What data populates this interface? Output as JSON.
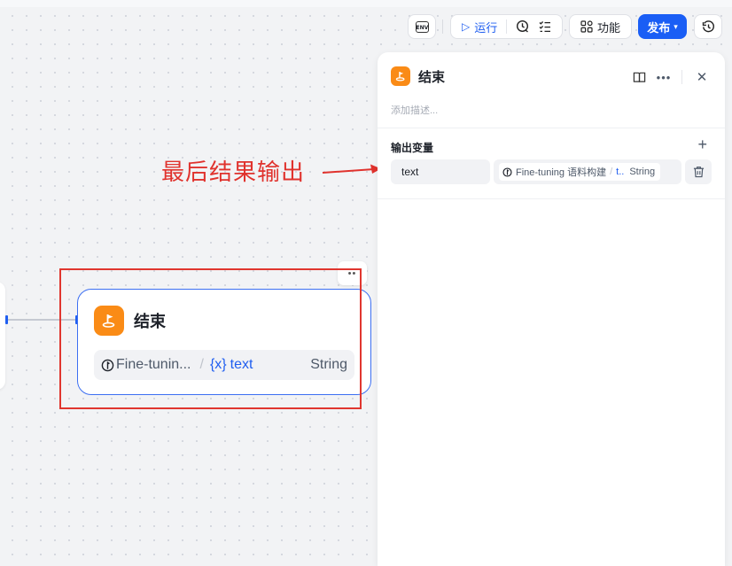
{
  "toolbar": {
    "env_label": "ENV",
    "run_label": "运行",
    "function_label": "功能",
    "publish_label": "发布"
  },
  "annotation": {
    "text": "最后结果输出",
    "color": "#e0322d"
  },
  "node": {
    "title": "结束",
    "output": {
      "source": "Fine-tunin...",
      "variable_marker": "{x}",
      "variable": "text",
      "type": "String"
    }
  },
  "panel": {
    "title": "结束",
    "description_placeholder": "添加描述...",
    "section_title": "输出变量",
    "variable": {
      "name": "text",
      "source": "Fine-tuning 语料构建",
      "value": "t..",
      "type": "String"
    }
  },
  "colors": {
    "accent": "#1a5ef5",
    "node_icon": "#fa8b16",
    "annotation": "#e0322d"
  }
}
